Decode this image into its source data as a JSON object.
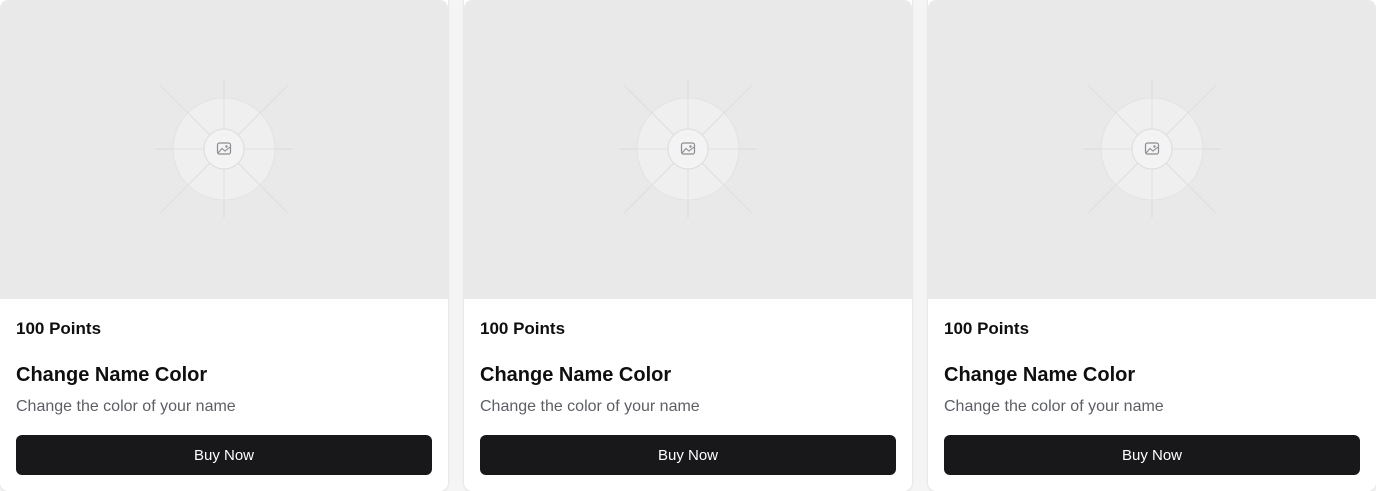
{
  "cards": [
    {
      "image_icon": "image-placeholder-icon",
      "points": "100 Points",
      "title": "Change Name Color",
      "description": "Change the color of your name",
      "button_label": "Buy Now"
    },
    {
      "image_icon": "image-placeholder-icon",
      "points": "100 Points",
      "title": "Change Name Color",
      "description": "Change the color of your name",
      "button_label": "Buy Now"
    },
    {
      "image_icon": "image-placeholder-icon",
      "points": "100 Points",
      "title": "Change Name Color",
      "description": "Change the color of your name",
      "button_label": "Buy Now"
    }
  ],
  "colors": {
    "image_background": "#e9e9ea",
    "button_background": "#18181b",
    "button_text": "#ffffff",
    "title_text": "#0f0f10",
    "description_text": "#5d5f66"
  }
}
